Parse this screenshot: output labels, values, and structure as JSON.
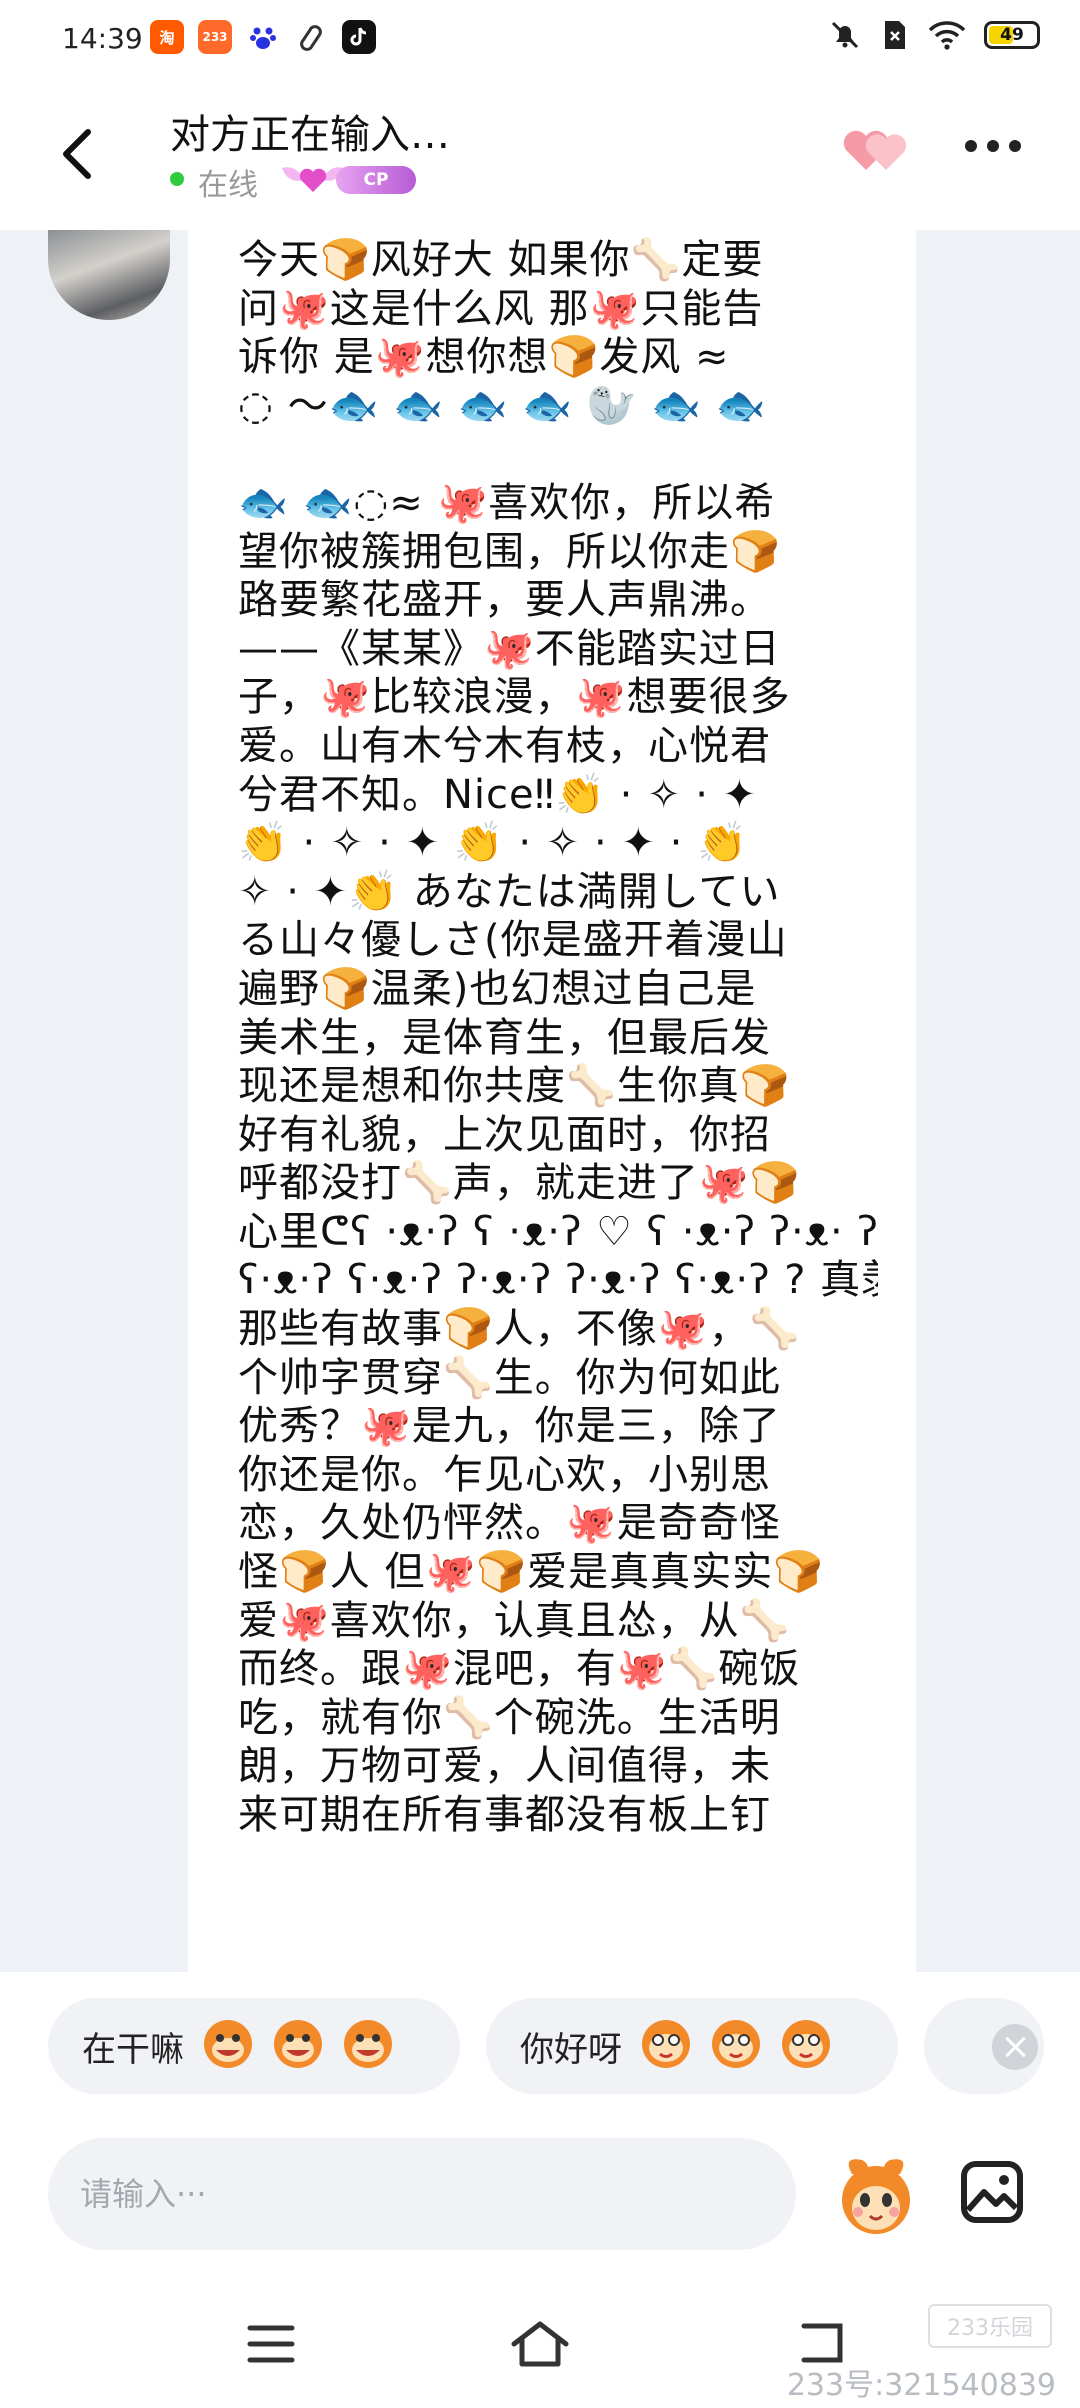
{
  "status_bar": {
    "time": "14:39",
    "apps": [
      {
        "name": "taobao-icon",
        "label": "淘",
        "color": "#ff5a00"
      },
      {
        "name": "app-233-icon",
        "label": "233",
        "color": "#ff6a2a"
      },
      {
        "name": "baidu-icon",
        "label": "",
        "color": "#2932e1"
      },
      {
        "name": "link-icon",
        "label": "",
        "color": "#333333"
      },
      {
        "name": "tiktok-icon",
        "label": "",
        "color": "#111111"
      }
    ],
    "battery": "49"
  },
  "header": {
    "title": "对方正在输入…",
    "status": "在线",
    "cp_badge": "CP"
  },
  "message": {
    "lines": [
      "今天🍞风好大 如果你🦴定要",
      "问🐙这是什么风 那🐙只能告",
      "诉你 是🐙想你想🍞发风 ≈",
      "◌ ～🐟 🐟 🐟 🐟 🦭 🐟 🐟",
      "",
      "🐟 🐟◌≈ 🐙喜欢你，所以希",
      "望你被簇拥包围，所以你走🍞",
      "路要繁花盛开，要人声鼎沸。",
      "——《某某》🐙不能踏实过日",
      "子，🐙比较浪漫，🐙想要很多",
      "爱。山有木兮木有枝，心悦君",
      "兮君不知。Nice‼👏 · ✧ · ✦",
      "👏 · ✧ · ✦ 👏 · ✧ · ✦ · 👏",
      "✧ · ✦👏 あなたは満開してい",
      "る山々優しさ(你是盛开着漫山",
      "遍野🍞温柔)也幻想过自己是",
      "美术生，是体育生，但最后发",
      "现还是想和你共度🦴生你真🍞",
      "好有礼貌，上次见面时，你招",
      "呼都没打🦴声，就走进了🐙🍞",
      "心里ᕦʕ ·ᴥ·ʔ ʕ ·ᴥ·ʔ ♡ ʕ ·ᴥ·ʔ ʔ·ᴥ· ʔ",
      "ʕ·ᴥ·ʔ ʕ·ᴥ·ʔ ʔ·ᴥ·ʔ ʔ·ᴥ·ʔ ʕ·ᴥ·ʔ ? 真羡慕",
      "那些有故事🍞人，不像🐙，🦴",
      "个帅字贯穿🦴生。你为何如此",
      "优秀？🐙是九，你是三，除了",
      "你还是你。乍见心欢，小别思",
      "恋，久处仍怦然。🐙是奇奇怪",
      "怪🍞人 但🐙🍞爱是真真实实🍞",
      "爱🐙喜欢你，认真且怂，从🦴",
      "而终。跟🐙混吧，有🐙🦴碗饭",
      "吃，就有你🦴个碗洗。生活明",
      "朗，万物可爱，人间值得，未",
      "来可期在所有事都没有板上钉"
    ]
  },
  "quick_replies": [
    {
      "text": "在干嘛"
    },
    {
      "text": "你好呀"
    }
  ],
  "input": {
    "placeholder": "请输入···"
  },
  "watermark": {
    "logo": "233乐园",
    "id": "233号:321540839"
  }
}
